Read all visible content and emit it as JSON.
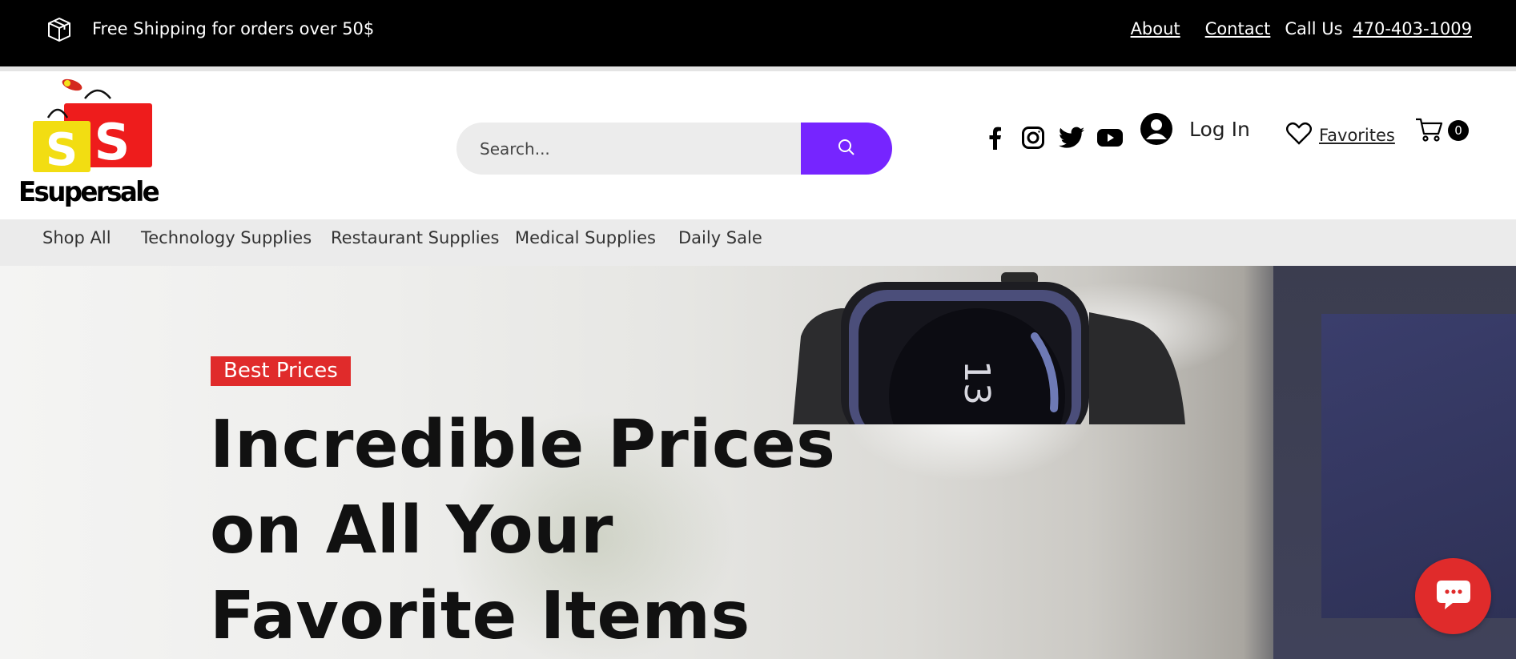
{
  "topbar": {
    "shipping_text": "Free Shipping for orders over 50$",
    "about": "About",
    "contact": "Contact",
    "call_label": "Call Us",
    "phone": "470-403-1009"
  },
  "brand": {
    "name": "Esupersale",
    "logo_letters": "S S"
  },
  "search": {
    "placeholder": "Search..."
  },
  "header": {
    "login": "Log In",
    "favorites": "Favorites",
    "cart_count": "0",
    "search_button_color": "#7625ff"
  },
  "social": [
    "facebook-icon",
    "instagram-icon",
    "twitter-icon",
    "youtube-icon"
  ],
  "nav": {
    "items": [
      {
        "label": "Shop All"
      },
      {
        "label": "Technology Supplies"
      },
      {
        "label": "Restaurant Supplies"
      },
      {
        "label": "Medical Supplies"
      },
      {
        "label": "Daily Sale"
      }
    ]
  },
  "hero": {
    "tag": "Best Prices",
    "tag_color": "#e02b2b",
    "line1": "Incredible Prices",
    "line2": "on All Your",
    "line3": "Favorite Items"
  }
}
